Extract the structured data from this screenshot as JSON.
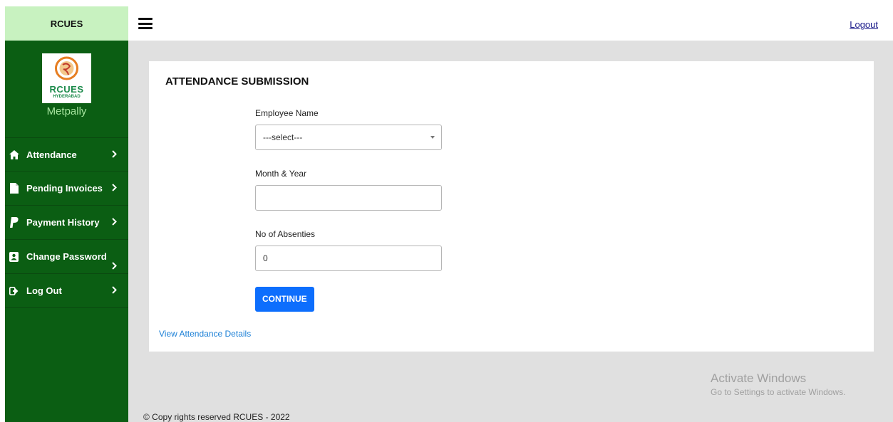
{
  "brand": {
    "name": "RCUES",
    "logo_text": "RCUES",
    "logo_sub": "HYDERABAD",
    "branch": "Metpally"
  },
  "sidebar": {
    "items": [
      {
        "label": "Attendance",
        "icon": "home-icon"
      },
      {
        "label": "Pending Invoices",
        "icon": "file-icon"
      },
      {
        "label": "Payment History",
        "icon": "paypal-icon"
      },
      {
        "label": "Change Password",
        "icon": "address-book-icon"
      },
      {
        "label": "Log Out",
        "icon": "sign-out-icon"
      }
    ]
  },
  "header": {
    "logout_label": "Logout"
  },
  "form": {
    "title": "ATTENDANCE SUBMISSION",
    "employee_label": "Employee Name",
    "employee_value": "---select---",
    "month_label": "Month & Year",
    "month_value": "",
    "absenties_label": "No of Absenties",
    "absenties_value": "0",
    "continue_label": "CONTINUE",
    "view_link": "View Attendance Details"
  },
  "watermark": {
    "title": "Activate Windows",
    "subtitle": "Go to Settings to activate Windows."
  },
  "footer": {
    "text": "© Copy rights reserved RCUES - 2022"
  },
  "colors": {
    "sidebar": "#0b5e13",
    "brand_bar": "#c8f2c0",
    "accent": "#0d6efd",
    "content_bg": "#e0e0e0"
  }
}
